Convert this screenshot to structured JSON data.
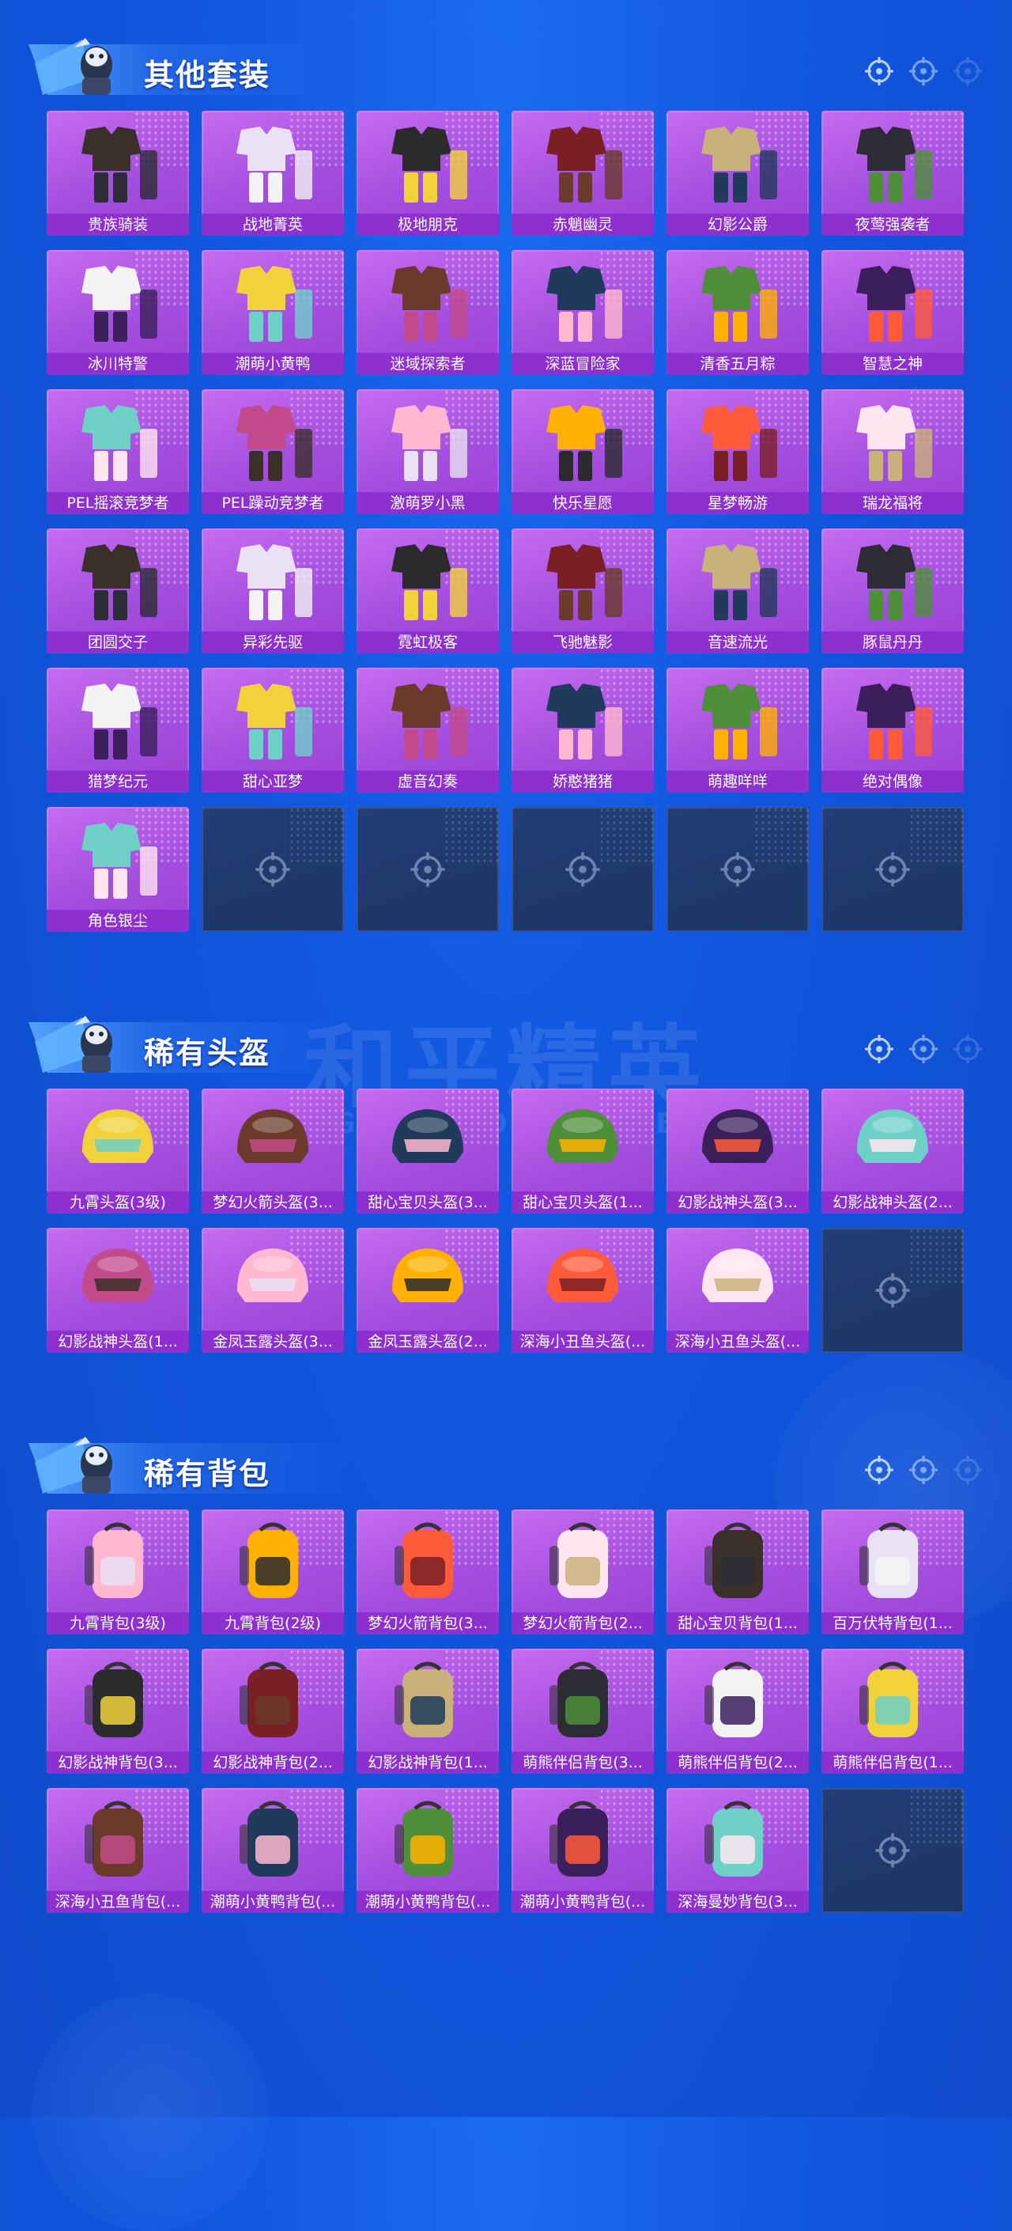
{
  "watermark": {
    "logo": "和平精英",
    "sub": "GAME FOR PEACE"
  },
  "colors": {
    "card": "#b05ae6",
    "label_bar": "#8e2fd0",
    "empty": "#1f3a6e",
    "background": "#1257e0"
  },
  "sections": [
    {
      "title": "其他套装",
      "item_icon": "outfit-icon",
      "items": [
        "贵族骑装",
        "战地菁英",
        "极地朋克",
        "赤魈幽灵",
        "幻影公爵",
        "夜莺强袭者",
        "冰川特警",
        "潮萌小黄鸭",
        "迷域探索者",
        "深蓝冒险家",
        "清香五月粽",
        "智慧之神",
        "PEL摇滚竞梦者",
        "PEL躁动竞梦者",
        "激萌罗小黑",
        "快乐星愿",
        "星梦畅游",
        "瑞龙福将",
        "团圆交子",
        "异彩先驱",
        "霓虹极客",
        "飞驰魅影",
        "音速流光",
        "豚鼠丹丹",
        "猎梦纪元",
        "甜心亚梦",
        "虚音幻奏",
        "娇憨猪猪",
        "萌趣咩咩",
        "绝对偶像",
        "角色银尘"
      ],
      "empty_slots": 5
    },
    {
      "title": "稀有头盔",
      "item_icon": "helmet-icon",
      "items": [
        "九霄头盔(3级)",
        "梦幻火箭头盔(3...",
        "甜心宝贝头盔(3...",
        "甜心宝贝头盔(1...",
        "幻影战神头盔(3...",
        "幻影战神头盔(2...",
        "幻影战神头盔(1...",
        "金凤玉露头盔(3...",
        "金凤玉露头盔(2...",
        "深海小丑鱼头盔(...",
        "深海小丑鱼头盔(..."
      ],
      "empty_slots": 1
    },
    {
      "title": "稀有背包",
      "item_icon": "backpack-icon",
      "items": [
        "九霄背包(3级)",
        "九霄背包(2级)",
        "梦幻火箭背包(3...",
        "梦幻火箭背包(2...",
        "甜心宝贝背包(1...",
        "百万伏特背包(1...",
        "幻影战神背包(3...",
        "幻影战神背包(2...",
        "幻影战神背包(1...",
        "萌熊伴侣背包(3...",
        "萌熊伴侣背包(2...",
        "萌熊伴侣背包(1...",
        "深海小丑鱼背包(...",
        "潮萌小黄鸭背包(...",
        "潮萌小黄鸭背包(...",
        "潮萌小黄鸭背包(...",
        "深海曼妙背包(3..."
      ],
      "empty_slots": 1
    }
  ]
}
